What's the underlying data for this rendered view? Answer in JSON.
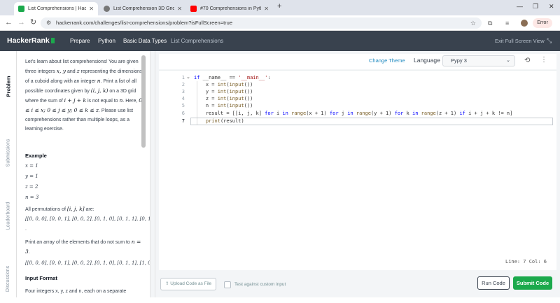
{
  "browser": {
    "tabs": [
      {
        "title": "List Comprehensions | HackerRank",
        "close": "✕",
        "favicon_color": "#1ba94c"
      },
      {
        "title": "List Comprehension 3D Grid",
        "close": "✕",
        "favicon_color": "#555555"
      },
      {
        "title": "#70 Comprehensions in Python",
        "close": "✕",
        "favicon_color": "#ff0000"
      }
    ],
    "new_tab": "+",
    "window_controls": {
      "minimize": "—",
      "maximize": "❐",
      "close": "✕"
    },
    "url": "hackerrank.com/challenges/list-comprehensions/problem?isFullScreen=true",
    "error_button": "Error"
  },
  "header": {
    "logo": "HackerRank",
    "breadcrumbs": [
      "Prepare",
      "Python",
      "Basic Data Types",
      "List Comprehensions"
    ],
    "exit_fullscreen": "Exit Full Screen View"
  },
  "side_tabs": [
    "Problem",
    "Submissions",
    "Leaderboard",
    "Discussions"
  ],
  "problem": {
    "intro_a": "Let's learn about list comprehensions! You are given three integers ",
    "intro_xyz": "x, y",
    "intro_and": " and ",
    "intro_z": "z",
    "intro_b": " representing the dimensions of a cuboid along with an integer ",
    "intro_n": "n",
    "intro_c": ". Print a list of all possible coordinates given by ",
    "intro_ijk": "(i, j, k)",
    "intro_d": " on a 3D grid where the sum of ",
    "intro_sum": "i + j + k",
    "intro_e": " is not equal to ",
    "intro_n2": "n",
    "intro_f": ". Here, ",
    "intro_bounds": "0 ≤ i ≤ x; 0 ≤ j ≤ y; 0 ≤ k ≤ z",
    "intro_g": ". Please use list comprehensions rather than multiple loops, as a learning exercise.",
    "example_heading": "Example",
    "example_vals": [
      "x = 1",
      "y = 1",
      "z = 2",
      "n = 3"
    ],
    "perm_text": "All permutations of ",
    "perm_var": "[i, j, k]",
    "perm_are": " are:",
    "perm_list": "[[0, 0, 0], [0, 0, 1], [0, 0, 2], [0, 1, 0], [0, 1, 1], [0, 1, 2]",
    "perm_dot": ".",
    "print_text": "Print an array of the elements that do not sum to ",
    "print_n": "n = 3",
    "print_dot": ".",
    "result_list": "[[0, 0, 0], [0, 0, 1], [0, 0, 2], [0, 1, 0], [0, 1, 1], [1, 0, 0]",
    "input_heading": "Input Format",
    "input_text": "Four integers x, y, z and n, each on a separate"
  },
  "editor": {
    "change_theme": "Change Theme",
    "language_label": "Language",
    "language": "Pypy 3",
    "line_numbers": [
      "1",
      "2",
      "3",
      "4",
      "5",
      "6",
      "7"
    ],
    "status": "Line: 7 Col: 6"
  },
  "bottom": {
    "upload": "Upload Code as File",
    "custom_input": "Test against custom input",
    "run": "Run Code",
    "submit": "Submit Code"
  }
}
